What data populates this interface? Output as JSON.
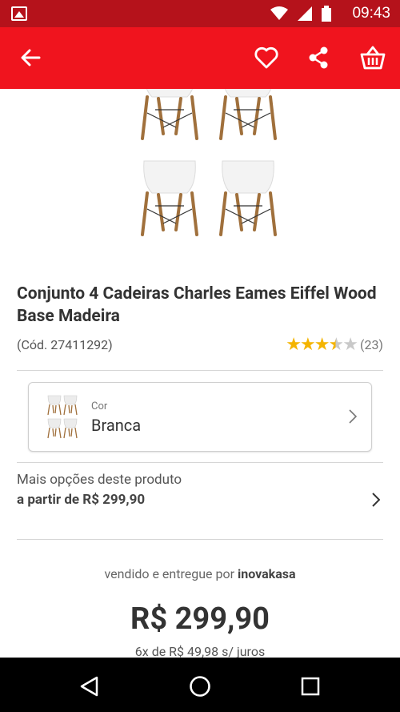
{
  "status_bar": {
    "time": "09:43"
  },
  "app_bar": {
    "accent_color": "#f0141e"
  },
  "product": {
    "title": "Conjunto 4 Cadeiras Charles Eames Eiffel Wood Base Madeira",
    "code": "(Cód. 27411292)",
    "rating": {
      "value": 3.5,
      "max": 5,
      "count": "(23)"
    }
  },
  "color_selector": {
    "label": "Cor",
    "value": "Branca"
  },
  "more_options": {
    "line1": "Mais opções deste produto",
    "line2": "a partir de R$ 299,90"
  },
  "seller": {
    "prefix": "vendido e entregue por",
    "name": "inovakasa"
  },
  "price": {
    "main": "R$ 299,90",
    "installments": "6x de R$ 49,98 s/ juros"
  }
}
